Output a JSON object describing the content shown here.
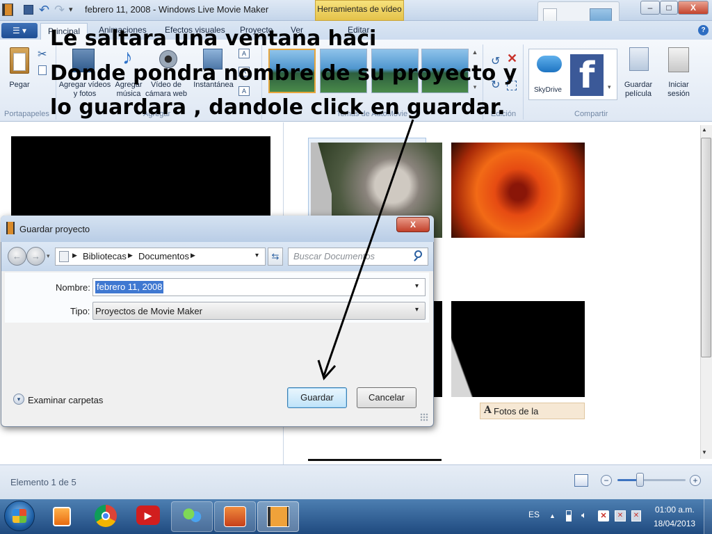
{
  "window": {
    "title": "febrero 11, 2008 - Windows Live Movie Maker",
    "context_tab": "Herramientas de vídeo",
    "controls": {
      "minimize": "–",
      "maximize": "□",
      "close": "X"
    }
  },
  "tabs": [
    "Principal",
    "Animaciones",
    "Efectos visuales",
    "Proyecto",
    "Ver",
    "Editar"
  ],
  "ribbon": {
    "paste_label": "Pegar",
    "add_videos_label": "Agregar vídeos y fotos",
    "add_music_label": "Agregar música",
    "webcam_label": "Vídeo de cámara web",
    "snapshot_label": "Instantánea",
    "skydrive_label": "SkyDrive",
    "save_movie_label": "Guardar película",
    "signin_label": "Iniciar sesión",
    "groups": {
      "clipboard": "Portapapeles",
      "add": "Agregar",
      "themes": "Temas de AutoMovie",
      "edit": "Edición",
      "share": "Compartir"
    }
  },
  "overlay": {
    "line1": "Le saltara una ventana haci",
    "line2": "Donde pondra nombre de su proyecto y",
    "line3": "lo guardara , dandole click en guardar."
  },
  "storyboard": {
    "caption": "Fotos de la"
  },
  "dialog": {
    "title": "Guardar proyecto",
    "breadcrumb": [
      "Bibliotecas",
      "Documentos"
    ],
    "search_placeholder": "Buscar Documentos",
    "name_label": "Nombre:",
    "name_value": "febrero 11, 2008",
    "type_label": "Tipo:",
    "type_value": "Proyectos de Movie Maker",
    "browse_label": "Examinar carpetas",
    "save_button": "Guardar",
    "cancel_button": "Cancelar",
    "close": "X"
  },
  "status": {
    "item_text": "Elemento 1 de 5"
  },
  "taskbar": {
    "language": "ES",
    "time": "01:00 a.m.",
    "date": "18/04/2013"
  }
}
